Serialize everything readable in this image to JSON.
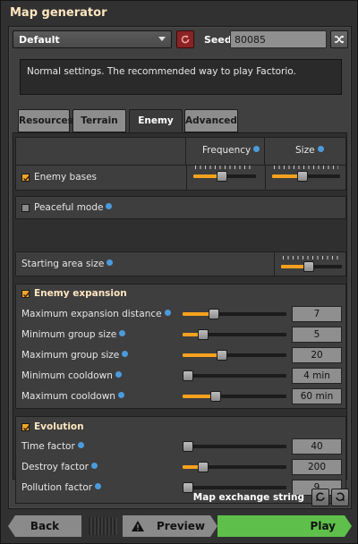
{
  "window": {
    "title": "Map generator"
  },
  "preset": {
    "value": "Default"
  },
  "seed": {
    "label": "Seed",
    "value": "80085"
  },
  "description": "Normal settings. The recommended way to play Factorio.",
  "tabs": [
    "Resources",
    "Terrain",
    "Enemy",
    "Advanced"
  ],
  "active_tab": "Enemy",
  "enemy_bases": {
    "label": "Enemy bases",
    "checked": true,
    "frequency_label": "Frequency",
    "size_label": "Size",
    "frequency_level": 0.45,
    "size_level": 0.45
  },
  "peaceful_mode": {
    "label": "Peaceful mode",
    "checked": false
  },
  "starting_area": {
    "label": "Starting area size",
    "level": 0.45
  },
  "enemy_expansion": {
    "label": "Enemy expansion",
    "checked": true,
    "rows": [
      {
        "label": "Maximum expansion distance",
        "value": "7",
        "level": 0.3
      },
      {
        "label": "Minimum group size",
        "value": "5",
        "level": 0.2
      },
      {
        "label": "Maximum group size",
        "value": "20",
        "level": 0.38
      },
      {
        "label": "Minimum cooldown",
        "value": "4 min",
        "level": 0.03
      },
      {
        "label": "Maximum cooldown",
        "value": "60 min",
        "level": 0.32
      }
    ]
  },
  "evolution": {
    "label": "Evolution",
    "checked": true,
    "rows": [
      {
        "label": "Time factor",
        "value": "40",
        "level": 0.04
      },
      {
        "label": "Destroy factor",
        "value": "200",
        "level": 0.2
      },
      {
        "label": "Pollution factor",
        "value": "9",
        "level": 0.02
      }
    ]
  },
  "map_exchange": {
    "label": "Map exchange string"
  },
  "buttons": {
    "back": "Back",
    "preview": "Preview",
    "play": "Play"
  },
  "colors": {
    "accent_orange": "#f6a11e",
    "play_green": "#5ec04a",
    "reset_red": "#8a2424",
    "info_blue": "#4b9bdc"
  }
}
